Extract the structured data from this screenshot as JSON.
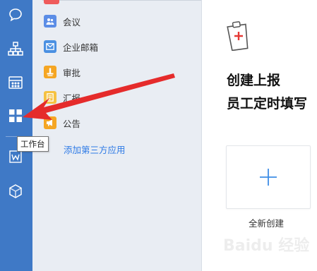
{
  "rail": {
    "icons": [
      "chat-icon",
      "org-chart-icon",
      "calendar-icon",
      "workbench-grid-icon",
      "doc-icon",
      "cube-icon"
    ]
  },
  "sidebar": {
    "items": [
      {
        "label": "会议",
        "icon": "meeting-icon",
        "color": "#5b8de6"
      },
      {
        "label": "企业邮箱",
        "icon": "mail-icon",
        "color": "#4a90e2"
      },
      {
        "label": "审批",
        "icon": "approval-icon",
        "color": "#f5a623"
      },
      {
        "label": "汇报",
        "icon": "report-icon",
        "color": "#f5c242"
      },
      {
        "label": "公告",
        "icon": "announcement-icon",
        "color": "#f5a623"
      }
    ],
    "add_app": "添加第三方应用"
  },
  "tooltip": "工作台",
  "main": {
    "heading_line1": "创建上报",
    "heading_line2": "员工定时填写",
    "create_label": "全新创建"
  },
  "watermark": "Baidu 经验",
  "colors": {
    "rail": "#3f79c6",
    "accent": "#2f7be6",
    "arrow": "#e52b2b"
  }
}
